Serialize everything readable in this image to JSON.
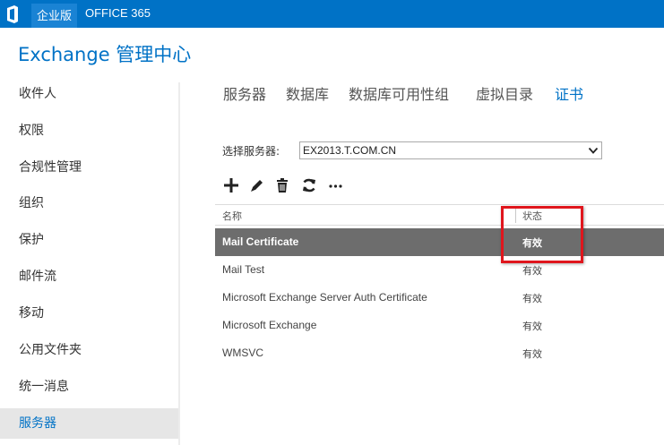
{
  "topbar": {
    "edition_label": "企业版",
    "office365_label": "OFFICE 365"
  },
  "app_title": "Exchange 管理中心",
  "left_nav": {
    "items": [
      {
        "label": "收件人"
      },
      {
        "label": "权限"
      },
      {
        "label": "合规性管理"
      },
      {
        "label": "组织"
      },
      {
        "label": "保护"
      },
      {
        "label": "邮件流"
      },
      {
        "label": "移动"
      },
      {
        "label": "公用文件夹"
      },
      {
        "label": "统一消息"
      },
      {
        "label": "服务器"
      }
    ],
    "active": "服务器"
  },
  "tabs": [
    {
      "label": "服务器"
    },
    {
      "label": "数据库"
    },
    {
      "label": "数据库可用性组"
    },
    {
      "label": "虚拟目录"
    },
    {
      "label": "证书"
    }
  ],
  "active_tab": "证书",
  "server_select": {
    "label": "选择服务器:",
    "value": "EX2013.T.COM.CN"
  },
  "toolbar": {
    "icons": [
      "add-icon",
      "edit-icon",
      "delete-icon",
      "refresh-icon",
      "more-icon"
    ],
    "more_label": "..."
  },
  "table": {
    "columns": {
      "name": "名称",
      "status": "状态"
    },
    "rows": [
      {
        "name": "Mail Certificate",
        "status": "有效",
        "selected": true
      },
      {
        "name": "Mail Test",
        "status": "有效",
        "selected": false
      },
      {
        "name": "Microsoft Exchange Server Auth Certificate",
        "status": "有效",
        "selected": false
      },
      {
        "name": "Microsoft Exchange",
        "status": "有效",
        "selected": false
      },
      {
        "name": "WMSVC",
        "status": "有效",
        "selected": false
      }
    ]
  },
  "colors": {
    "brand": "#0072c6",
    "selected_row": "#6d6d6d",
    "highlight": "#e0161d"
  }
}
